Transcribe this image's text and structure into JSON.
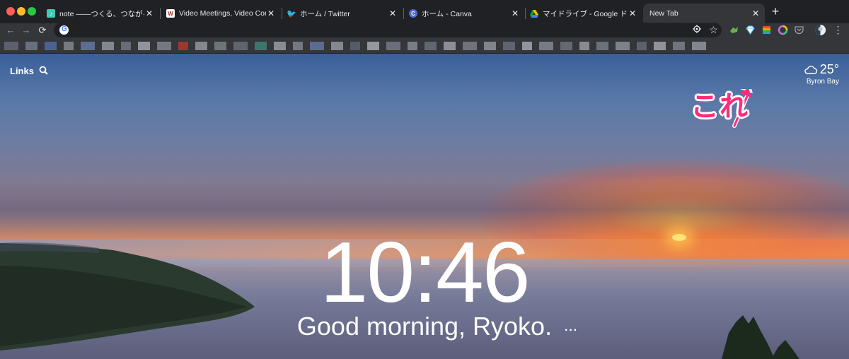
{
  "window": {
    "traffic_lights": [
      "close",
      "minimize",
      "zoom"
    ]
  },
  "tabs": [
    {
      "title": "note ——つくる、つながる、とど",
      "favicon": "note-icon",
      "favicon_color": "#41c9b4",
      "active": false
    },
    {
      "title": "Video Meetings, Video Confere",
      "favicon": "zoom-wall-icon",
      "favicon_color": "#ffffff",
      "active": false
    },
    {
      "title": "ホーム / Twitter",
      "favicon": "twitter-icon",
      "favicon_color": "#1da1f2",
      "active": false
    },
    {
      "title": "ホーム - Canva",
      "favicon": "canva-icon",
      "favicon_color": "#4f6cd6",
      "active": false
    },
    {
      "title": "マイドライブ - Google ドライブ",
      "favicon": "google-drive-icon",
      "favicon_color": "#fbbc04",
      "active": false
    },
    {
      "title": "New Tab",
      "favicon": "",
      "favicon_color": "",
      "active": true
    }
  ],
  "toolbar": {
    "new_tab_symbol": "+",
    "back_symbol": "←",
    "forward_symbol": "→",
    "reload_symbol": "⟳",
    "address_value": "",
    "bookmark_symbol": "☆",
    "menu_symbol": "⋮"
  },
  "extensions": [
    {
      "name": "green-extension-icon",
      "color": "#6ab04c"
    },
    {
      "name": "diamond-extension-icon",
      "color": "#5bc0eb"
    },
    {
      "name": "stripes-extension-icon",
      "color": "#f0a500"
    },
    {
      "name": "color-ring-extension-icon",
      "color": "#c86dd7"
    },
    {
      "name": "pocket-extension-icon",
      "color": "#9aa0a6"
    }
  ],
  "bookmarks_bar_colors": [
    "#6b6e80",
    "#7a8396",
    "#5670b0",
    "#8c9199",
    "#6a7fb2",
    "#9ea3ab",
    "#7a7f8c",
    "#b0b4bb",
    "#8a8f98",
    "#c0392b",
    "#9ea3ab",
    "#7f8c8d",
    "#6e7580",
    "#3e8e7e",
    "#a5aab2",
    "#8a8f98",
    "#6b7cb0",
    "#a0a4ab",
    "#5f6a7a",
    "#b5b9bf",
    "#7d8290",
    "#9096a0",
    "#6f7785",
    "#a8acb4",
    "#818792",
    "#9aa0a8",
    "#6c7483",
    "#b2b6bd",
    "#8c93a0",
    "#747b88",
    "#a1a6ae",
    "#7e8591",
    "#959ba5",
    "#6a717e",
    "#aeb2b9",
    "#848a96",
    "#9da2ab"
  ],
  "ntp": {
    "links_label": "Links",
    "weather_temp": "25°",
    "weather_location": "Byron Bay",
    "clock": "10:46",
    "greeting": "Good morning, Ryoko.",
    "greeting_more": "···"
  },
  "annotation": {
    "text": "これ",
    "color": "#ff2b7a"
  }
}
